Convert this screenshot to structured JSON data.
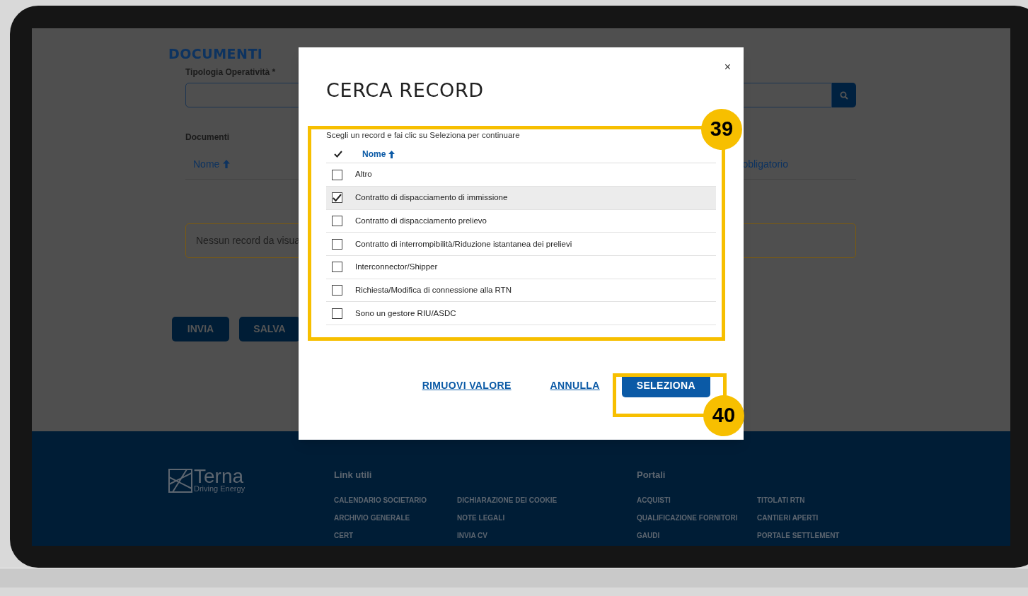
{
  "page": {
    "title": "DOCUMENTI",
    "field_label": "Tipologia Operatività *",
    "section_label": "Documenti",
    "columns": [
      "Nome",
      "obligatorio"
    ],
    "empty_message": "Nessun record da visua",
    "buttons": [
      "INVIA",
      "SALVA"
    ]
  },
  "footer": {
    "logo_name": "Terna",
    "logo_tagline": "Driving Energy",
    "groups": [
      {
        "title": "Link utili",
        "columns": [
          [
            "CALENDARIO SOCIETARIO",
            "ARCHIVIO GENERALE",
            "CERT"
          ],
          [
            "DICHIARAZIONE DEI COOKIE",
            "NOTE LEGALI",
            "INVIA CV"
          ]
        ]
      },
      {
        "title": "Portali",
        "columns": [
          [
            "ACQUISTI",
            "QUALIFICAZIONE FORNITORI",
            "GAUDI"
          ],
          [
            "TITOLATI RTN",
            "CANTIERI APERTI",
            "PORTALE SETTLEMENT"
          ]
        ]
      }
    ]
  },
  "modal": {
    "title": "CERCA RECORD",
    "close": "×",
    "instruction": "Scegli un record e fai clic su Seleziona per continuare",
    "column": "Nome",
    "rows": [
      {
        "label": "Altro",
        "checked": false
      },
      {
        "label": "Contratto di dispacciamento di immissione",
        "checked": true
      },
      {
        "label": "Contratto di dispacciamento prelievo",
        "checked": false
      },
      {
        "label": "Contratto di interrompibilità/Riduzione istantanea dei prelievi",
        "checked": false
      },
      {
        "label": "Interconnector/Shipper",
        "checked": false
      },
      {
        "label": "Richiesta/Modifica di connessione alla RTN",
        "checked": false
      },
      {
        "label": "Sono un gestore RIU/ASDC",
        "checked": false
      }
    ],
    "actions": [
      {
        "label": "RIMUOVI VALORE",
        "kind": "link"
      },
      {
        "label": "ANNULLA",
        "kind": "link"
      },
      {
        "label": "SELEZIONA",
        "kind": "primary"
      }
    ]
  },
  "callouts": [
    "39",
    "40"
  ]
}
